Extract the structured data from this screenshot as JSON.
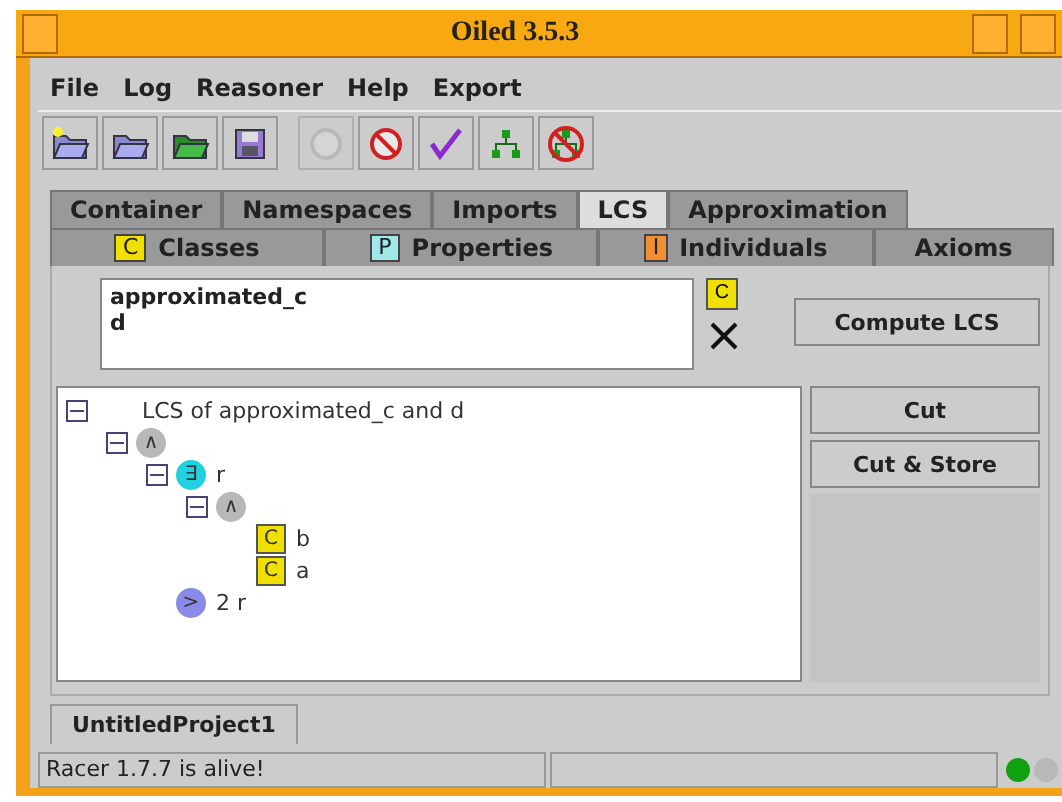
{
  "window": {
    "title": "Oiled 3.5.3"
  },
  "menu": [
    "File",
    "Log",
    "Reasoner",
    "Help",
    "Export"
  ],
  "toolbar": [
    {
      "kind": "new",
      "disabled": false
    },
    {
      "kind": "open",
      "disabled": false
    },
    {
      "kind": "open-green",
      "disabled": false
    },
    {
      "kind": "save",
      "disabled": false
    },
    {
      "kind": "dig",
      "disabled": true
    },
    {
      "kind": "no-dig",
      "disabled": false
    },
    {
      "kind": "check",
      "disabled": false
    },
    {
      "kind": "hierarchy",
      "disabled": false
    },
    {
      "kind": "no-hierarchy",
      "disabled": false
    }
  ],
  "tabs_top": [
    {
      "label": "Container",
      "selected": false
    },
    {
      "label": "Namespaces",
      "selected": false
    },
    {
      "label": "Imports",
      "selected": false
    },
    {
      "label": "LCS",
      "selected": true
    },
    {
      "label": "Approximation",
      "selected": false
    }
  ],
  "tabs_bottom": [
    {
      "label": "Classes",
      "badge": "C",
      "color": "#f0e000",
      "selected": false
    },
    {
      "label": "Properties",
      "badge": "P",
      "color": "#9ee8ea",
      "selected": false
    },
    {
      "label": "Individuals",
      "badge": "I",
      "color": "#f09030",
      "selected": false
    },
    {
      "label": "Axioms",
      "selected": false
    }
  ],
  "concepts": {
    "lines": [
      "approximated_c",
      "d"
    ],
    "add_badge": "C"
  },
  "buttons": {
    "compute": "Compute LCS",
    "cut": "Cut",
    "cut_store": "Cut & Store"
  },
  "tree": [
    {
      "kind": "root",
      "label": "LCS of approximated_c and d",
      "expanded": true,
      "children": [
        {
          "kind": "and",
          "glyph": "∧",
          "expanded": true,
          "children": [
            {
              "kind": "some",
              "glyph": "∃",
              "label": "r",
              "expanded": true,
              "children": [
                {
                  "kind": "and",
                  "glyph": "∧",
                  "expanded": true,
                  "children": [
                    {
                      "kind": "class",
                      "glyph": "C",
                      "label": "b"
                    },
                    {
                      "kind": "class",
                      "glyph": "C",
                      "label": "a"
                    }
                  ]
                }
              ]
            },
            {
              "kind": "atleast",
              "glyph": ">",
              "label": "2 r"
            }
          ]
        }
      ]
    }
  ],
  "project_tab": {
    "label": "UntitledProject1"
  },
  "status_bar": {
    "message": "Racer 1.7.7 is alive!",
    "lights": [
      {
        "color": "#10a010"
      },
      {
        "color": "#b8b8b8"
      }
    ]
  }
}
